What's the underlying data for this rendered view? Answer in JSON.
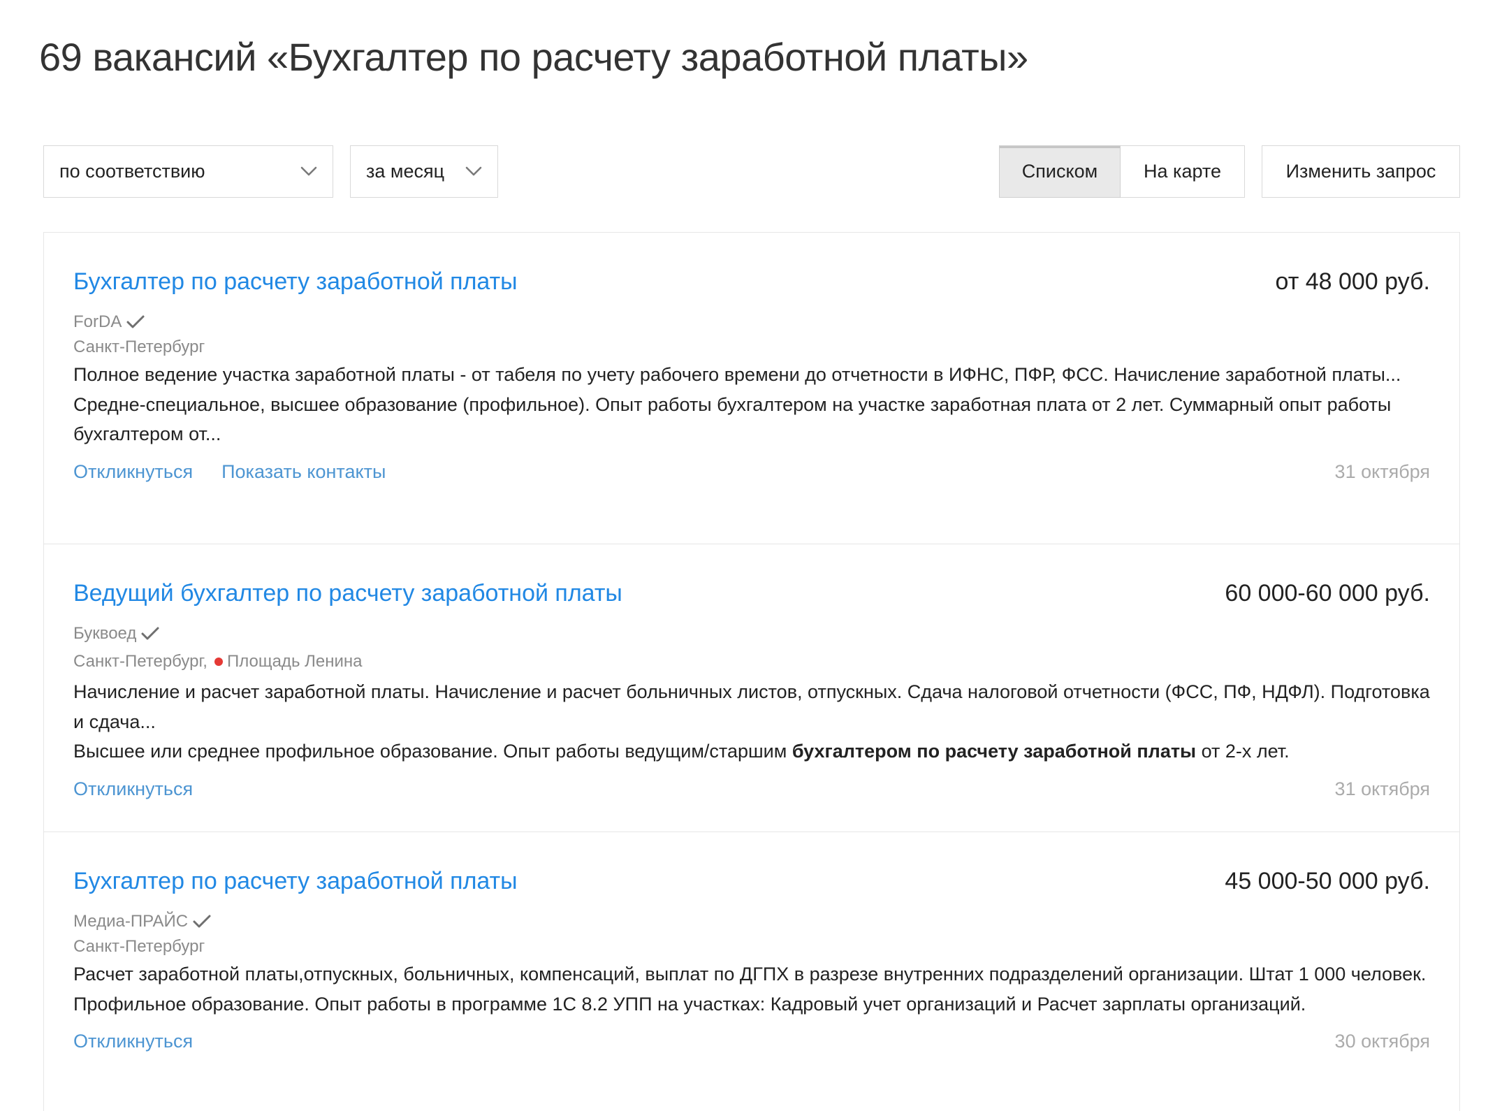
{
  "page": {
    "title": "69 вакансий «Бухгалтер по расчету заработной платы»"
  },
  "filters": {
    "sort": {
      "value": "по соответствию"
    },
    "period": {
      "value": "за месяц"
    }
  },
  "view_toggle": [
    {
      "label": "Списком",
      "selected": true
    },
    {
      "label": "На карте",
      "selected": false
    }
  ],
  "edit_query_label": "Изменить запрос",
  "vacancies": [
    {
      "title": "Бухгалтер по расчету заработной платы",
      "salary": "от 48 000 руб.",
      "company": "ForDA",
      "verified": true,
      "location": "Санкт-Петербург",
      "description": "Полное ведение участка заработной платы - от табеля по учету рабочего времени до отчетности в ИФНС, ПФР, ФСС. Начисление заработной платы...",
      "requirements": [
        {
          "text": "Средне-специальное, высшее образование (профильное). Опыт работы бухгалтером на участке заработная плата от 2 лет. Суммарный опыт работы бухгалтером от...",
          "bold": false
        }
      ],
      "actions": [
        "Откликнуться",
        "Показать контакты"
      ],
      "date": "31 октября"
    },
    {
      "title": "Ведущий бухгалтер по расчету заработной платы",
      "salary": "60 000-60 000 руб.",
      "company": "Буквоед",
      "verified": true,
      "location": "Санкт-Петербург,",
      "metro": {
        "name": "Площадь Ленина",
        "line_color": "#e53935"
      },
      "description": "Начисление и расчет заработной платы. Начисление и расчет больничных листов, отпускных. Сдача налоговой отчетности (ФСС, ПФ, НДФЛ). Подготовка и сдача...",
      "requirements": [
        {
          "text": "Высшее или среднее профильное образование. Опыт работы ведущим/старшим ",
          "bold": false
        },
        {
          "text": "бухгалтером по расчету заработной платы",
          "bold": true
        },
        {
          "text": " от 2-х лет.",
          "bold": false
        }
      ],
      "actions": [
        "Откликнуться"
      ],
      "date": "31 октября"
    },
    {
      "title": "Бухгалтер по расчету заработной платы",
      "salary": "45 000-50 000 руб.",
      "company": "Медиа-ПРАЙС",
      "verified": true,
      "location": "Санкт-Петербург",
      "description": "Расчет заработной платы,отпускных, больничных, компенсаций, выплат по ДГПХ в разрезе внутренних подразделений организации. Штат 1 000 человек.",
      "requirements": [
        {
          "text": "Профильное образование. Опыт работы в программе 1С 8.2 УПП на участках: Кадровый учет организаций и Расчет зарплаты организаций.",
          "bold": false
        }
      ],
      "actions": [
        "Откликнуться"
      ],
      "date": "30 октября"
    }
  ]
}
